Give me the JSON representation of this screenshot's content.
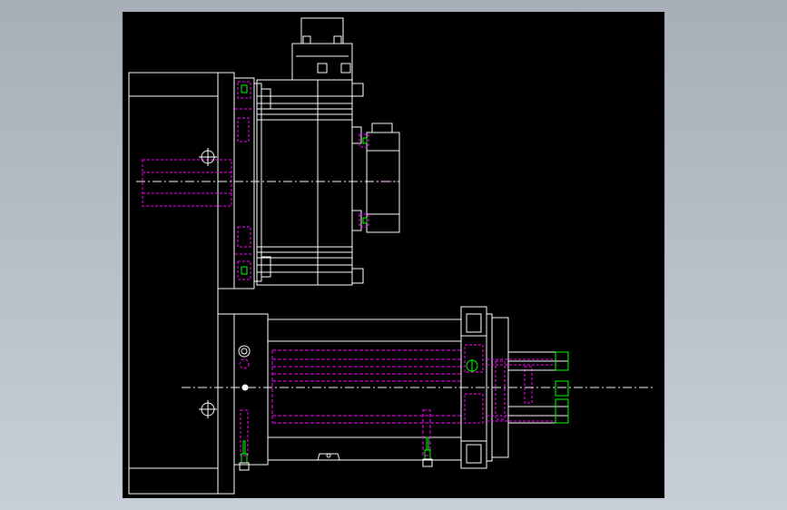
{
  "viewer": {
    "background_gradient": [
      "#a7aeb8",
      "#c9cfd8"
    ],
    "canvas_color": "#000000"
  },
  "drawing": {
    "line_color": "#ffffff",
    "hidden_line_color": "#ff00ff",
    "accent_color": "#00ff00",
    "centerline_color": "#ffffff",
    "views": [
      "front-view-upper-motor-assembly",
      "front-view-lower-cylinder-assembly"
    ]
  }
}
